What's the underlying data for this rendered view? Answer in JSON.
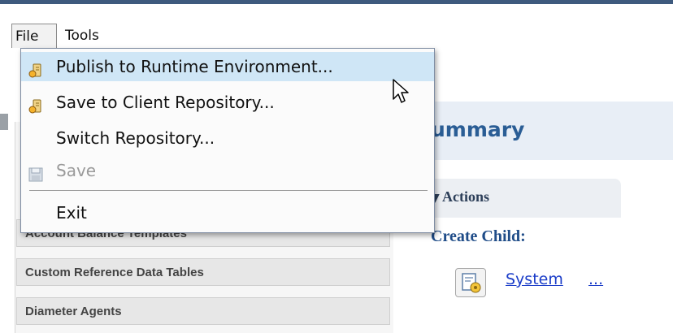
{
  "menubar": {
    "file_label": "File",
    "tools_label": "Tools"
  },
  "file_menu": {
    "items": [
      {
        "label": "Publish to Runtime Environment...",
        "icon": "publish-icon",
        "state": "highlighted"
      },
      {
        "label": "Save to Client Repository...",
        "icon": "repository-save-icon",
        "state": "normal"
      },
      {
        "label": "Switch Repository...",
        "icon": "",
        "state": "normal"
      },
      {
        "label": "Save",
        "icon": "save-disk-icon",
        "state": "disabled"
      },
      {
        "label": "Exit",
        "icon": "",
        "state": "normal"
      }
    ]
  },
  "left_nav": {
    "items": [
      {
        "label": "Account Balance Templates"
      },
      {
        "label": "Custom Reference Data Tables"
      },
      {
        "label": "Diameter Agents"
      }
    ]
  },
  "summary": {
    "title_visible": "ummary"
  },
  "actions": {
    "title": "Actions",
    "create_child_label": "Create Child:",
    "child_link_label": "System",
    "child_more_label": "..."
  },
  "colors": {
    "menu_highlight": "#cfe6f6",
    "summary_title": "#2a5d95",
    "link": "#1a3cc8",
    "top_rule": "#3e5a7e"
  }
}
